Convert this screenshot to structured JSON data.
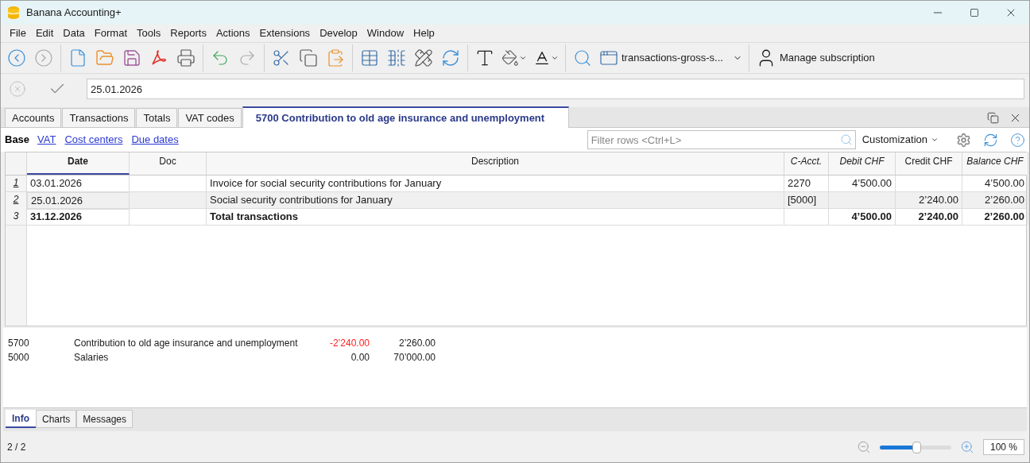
{
  "window": {
    "title": "Banana Accounting+"
  },
  "menu": [
    "File",
    "Edit",
    "Data",
    "Format",
    "Tools",
    "Reports",
    "Actions",
    "Extensions",
    "Develop",
    "Window",
    "Help"
  ],
  "toolbar": {
    "layout_selector": "transactions-gross-s...",
    "subscription": "Manage subscription"
  },
  "edit_bar": {
    "value": "25.01.2026"
  },
  "tabs": [
    {
      "label": "Accounts",
      "selected": false
    },
    {
      "label": "Transactions",
      "selected": false
    },
    {
      "label": "Totals",
      "selected": false
    },
    {
      "label": "VAT codes",
      "selected": false
    },
    {
      "label": "5700 Contribution to old age insurance and unemployment",
      "selected": true
    }
  ],
  "views": [
    {
      "label": "Base",
      "selected": true
    },
    {
      "label": "VAT",
      "selected": false
    },
    {
      "label": "Cost centers",
      "selected": false
    },
    {
      "label": "Due dates",
      "selected": false
    }
  ],
  "filter": {
    "placeholder": "Filter rows <Ctrl+L>"
  },
  "customization": "Customization",
  "table": {
    "columns": [
      "Date",
      "Doc",
      "Description",
      "C-Acct.",
      "Debit CHF",
      "Credit CHF",
      "Balance CHF"
    ],
    "rows": [
      {
        "number": "1",
        "selected": false,
        "total": false,
        "cells": [
          "03.01.2026",
          null,
          "Invoice for social security contributions for January",
          "2270",
          "4’500.00",
          null,
          "4’500.00"
        ]
      },
      {
        "number": "2",
        "selected": true,
        "total": false,
        "cells": [
          "25.01.2026",
          null,
          "Social security contributions for January",
          "[5000]",
          null,
          "2’240.00",
          "2’260.00"
        ]
      },
      {
        "number": "3",
        "selected": false,
        "total": true,
        "cells": [
          "31.12.2026",
          null,
          "Total transactions",
          null,
          "4’500.00",
          "2’240.00",
          "2’260.00"
        ]
      }
    ]
  },
  "info": [
    {
      "account": "5700",
      "description": "Contribution to old age insurance and unemployment",
      "amount": "-2’240.00",
      "negative": true,
      "balance": "2’260.00"
    },
    {
      "account": "5000",
      "description": "Salaries",
      "amount": "0.00",
      "negative": false,
      "balance": "70’000.00"
    }
  ],
  "bottom_tabs": [
    {
      "label": "Info",
      "selected": true
    },
    {
      "label": "Charts",
      "selected": false
    },
    {
      "label": "Messages",
      "selected": false
    }
  ],
  "status": {
    "count": "2 / 2",
    "zoom": {
      "level": 0.51,
      "value": "100 %"
    }
  }
}
